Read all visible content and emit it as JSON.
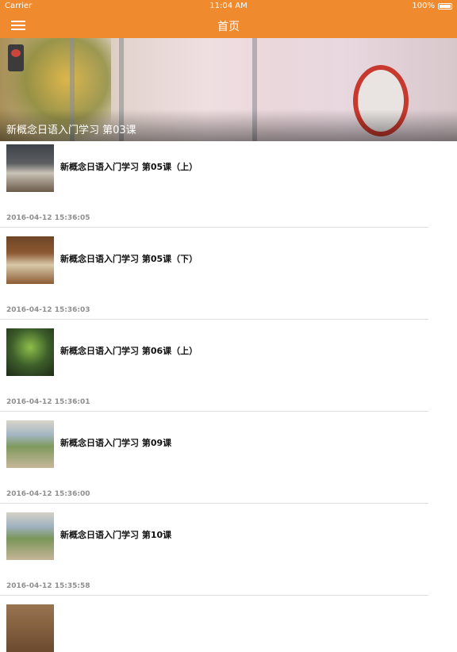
{
  "status_bar": {
    "carrier": "Carrier",
    "time": "11:04 AM",
    "battery": "100%"
  },
  "nav": {
    "title": "首页"
  },
  "banner": {
    "title": "新概念日语入门学习 第03课"
  },
  "articles": [
    {
      "title": "新概念日语入门学习 第05课（上）",
      "date": "2016-04-12 15:36:05"
    },
    {
      "title": "新概念日语入门学习 第05课（下）",
      "date": "2016-04-12 15:36:03"
    },
    {
      "title": "新概念日语入门学习 第06课（上）",
      "date": "2016-04-12 15:36:01"
    },
    {
      "title": "新概念日语入门学习 第09课",
      "date": "2016-04-12 15:36:00"
    },
    {
      "title": "新概念日语入门学习 第10课",
      "date": "2016-04-12 15:35:58"
    }
  ],
  "theme": {
    "accent": "#ef8a2f"
  }
}
